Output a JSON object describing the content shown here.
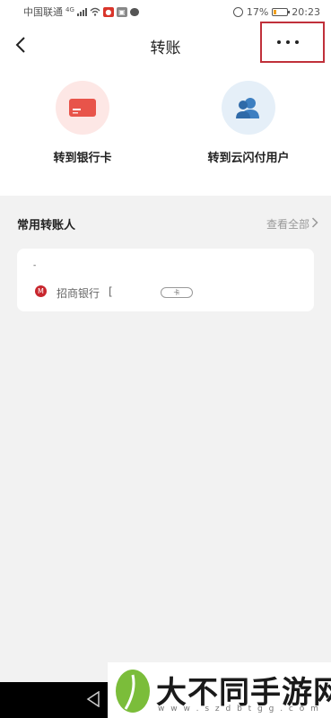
{
  "status_bar": {
    "carrier": "中国联通",
    "network": "4G",
    "battery_percent": "17%",
    "time": "20:23"
  },
  "nav": {
    "title": "转账",
    "back_icon": "chevron-left-icon",
    "more_icon": "more-dots-icon"
  },
  "quick_actions": [
    {
      "label": "转到银行卡",
      "icon": "bank-card-icon",
      "color": "#e8544a"
    },
    {
      "label": "转到云闪付用户",
      "icon": "users-icon",
      "color": "#3d7fc1"
    }
  ],
  "frequent": {
    "title": "常用转账人",
    "see_all": "查看全部",
    "payees": [
      {
        "name": "-",
        "bank": "招商银行",
        "card_no": "[",
        "tag": "卡"
      }
    ]
  },
  "watermark": {
    "title": "大不同手游网",
    "url": "w w w . s z d b t g g . c o m"
  }
}
